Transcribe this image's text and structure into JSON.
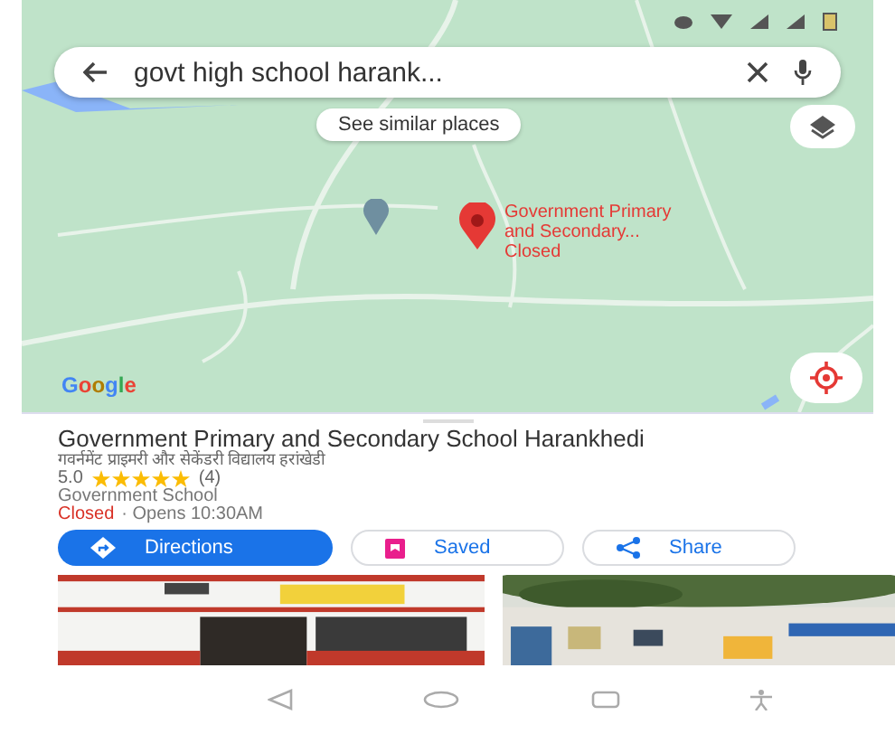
{
  "search": {
    "value": "govt high school harank..."
  },
  "similar_button": "See similar places",
  "map_pin": {
    "label_lines": [
      "Government Primary",
      "and Secondary..."
    ],
    "status": "Closed"
  },
  "map_logo": "Google",
  "place": {
    "name": "Government Primary and Secondary School Harankhedi",
    "local_name": "गवर्नमेंट प्राइमरी और सेकेंडरी विद्यालय हरांखेडी",
    "rating": "5.0",
    "stars": 5,
    "reviews": "(4)",
    "category": "Government School",
    "status": "Closed",
    "open": false,
    "hours": "· Opens 10:30AM"
  },
  "actions": [
    {
      "label": "Directions",
      "kind": "primary"
    },
    {
      "label": "Saved",
      "kind": "saved"
    },
    {
      "label": "Share",
      "kind": "share"
    }
  ]
}
